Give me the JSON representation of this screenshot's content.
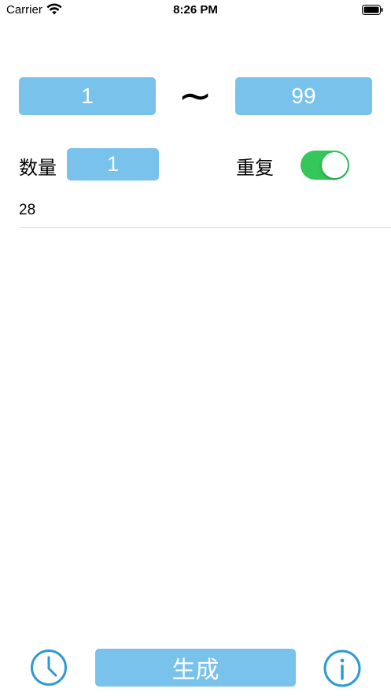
{
  "status_bar": {
    "carrier": "Carrier",
    "time": "8:26 PM"
  },
  "range": {
    "min": "1",
    "separator": "~",
    "max": "99"
  },
  "options": {
    "count_label": "数量",
    "count_value": "1",
    "repeat_label": "重复",
    "repeat_enabled": true
  },
  "result": {
    "value": "28"
  },
  "bottom_bar": {
    "generate_label": "生成",
    "history_icon": "clock-icon",
    "info_icon": "info-icon"
  },
  "colors": {
    "accent": "#78c2ec",
    "icon": "#2e9ad0",
    "toggle_on": "#34c759"
  }
}
